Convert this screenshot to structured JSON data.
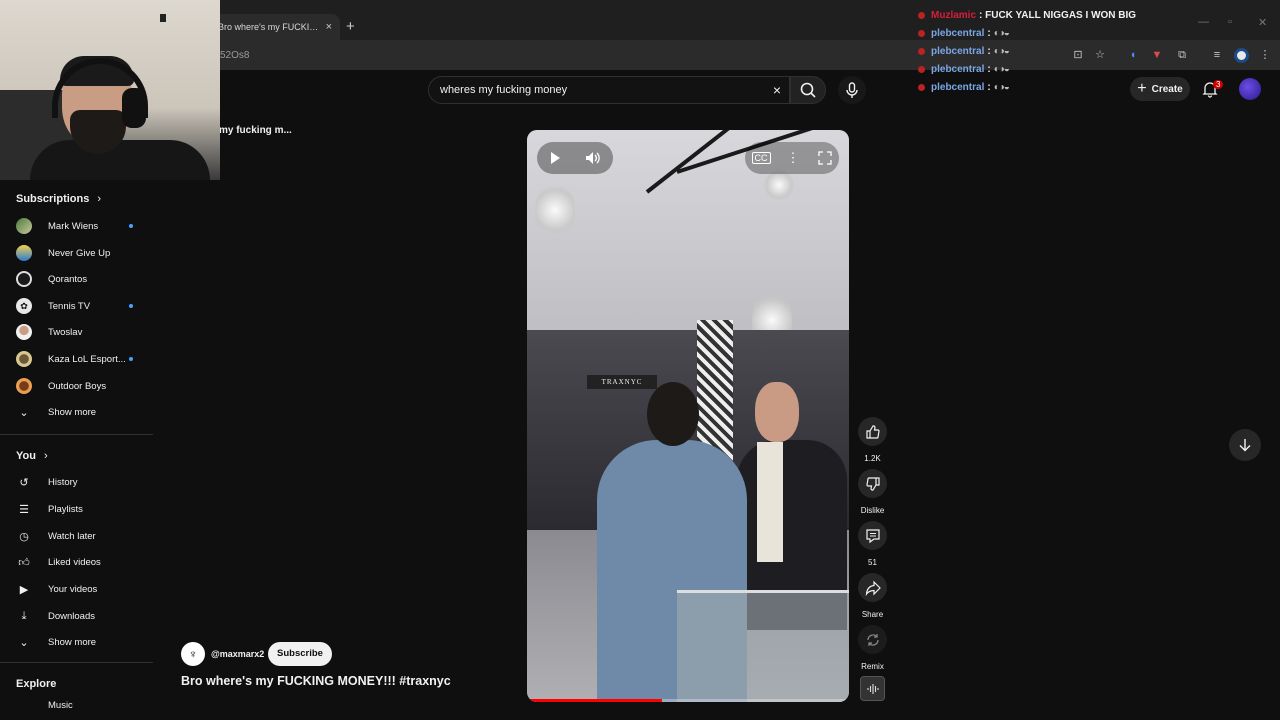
{
  "browser": {
    "tab_title": "Bro where's my FUCKING M",
    "tab_close": "×",
    "new_tab": "+",
    "url_fragment": "52Os8"
  },
  "header": {
    "search_query": "wheres my fucking money",
    "clear_icon": "×",
    "create_label": "Create",
    "create_plus": "+",
    "notification_count": "3"
  },
  "breadcrumb": "my fucking m...",
  "chat": {
    "lines": [
      {
        "user": "Muzlamic",
        "user_color": "#d61f3a",
        "message": ": FUCK YALL NIGGAS I WON BIG"
      },
      {
        "user": "plebcentral",
        "user_color": "#7aa7e6",
        "message": ":"
      },
      {
        "user": "plebcentral",
        "user_color": "#7aa7e6",
        "message": ":"
      },
      {
        "user": "plebcentral",
        "user_color": "#7aa7e6",
        "message": ":"
      },
      {
        "user": "plebcentral",
        "user_color": "#7aa7e6",
        "message": ":"
      }
    ]
  },
  "sidebar": {
    "subscriptions_heading": "Subscriptions",
    "subscriptions": [
      {
        "label": "Mark Wiens",
        "new": true
      },
      {
        "label": "Never Give Up",
        "new": false
      },
      {
        "label": "Qorantos",
        "new": false
      },
      {
        "label": "Tennis TV",
        "new": true
      },
      {
        "label": "Twoslav",
        "new": false
      },
      {
        "label": "Kaza LoL Esport...",
        "new": true
      },
      {
        "label": "Outdoor Boys",
        "new": false
      }
    ],
    "show_more_1": "Show more",
    "you_heading": "You",
    "you_items": [
      {
        "label": "History",
        "icon": "history-icon"
      },
      {
        "label": "Playlists",
        "icon": "playlists-icon"
      },
      {
        "label": "Watch later",
        "icon": "watch-later-icon"
      },
      {
        "label": "Liked videos",
        "icon": "liked-icon"
      },
      {
        "label": "Your videos",
        "icon": "your-videos-icon"
      },
      {
        "label": "Downloads",
        "icon": "downloads-icon"
      }
    ],
    "show_more_2": "Show more",
    "explore_heading": "Explore",
    "explore_partial": "Music"
  },
  "video": {
    "store_sign": "TRAXNYC",
    "progress_fraction": 0.42
  },
  "actions": {
    "like_count": "1.2K",
    "dislike_label": "Dislike",
    "comment_count": "51",
    "share_label": "Share",
    "remix_label": "Remix"
  },
  "meta": {
    "channel": "@maxmarx2",
    "subscribe_label": "Subscribe",
    "title": "Bro where's my FUCKING MONEY!!! #traxnyc"
  },
  "colors": {
    "background": "#0f0f0f",
    "accent_blue": "#3ea6ff",
    "progress_red": "#ff0000"
  }
}
